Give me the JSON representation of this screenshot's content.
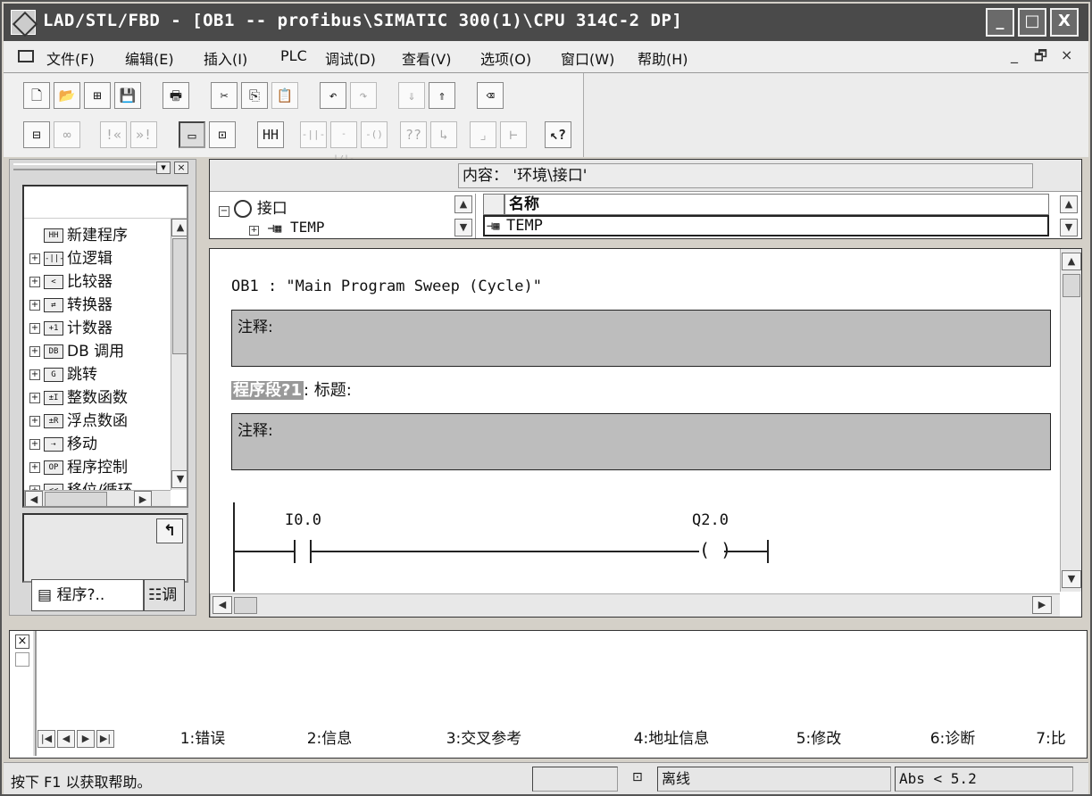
{
  "window": {
    "title": "LAD/STL/FBD  - [OB1 -- profibus\\SIMATIC 300(1)\\CPU 314C-2 DP]",
    "min_label": "_",
    "max_label": "□",
    "close_label": "X"
  },
  "menu": {
    "items": [
      "文件(F)",
      "编辑(E)",
      "插入(I)",
      "PLC",
      "调试(D)",
      "查看(V)",
      "选项(O)",
      "窗口(W)",
      "帮助(H)"
    ],
    "mdi_min": "_",
    "mdi_restore": "🗗",
    "mdi_close": "×"
  },
  "toolbar": {
    "row1": [
      {
        "icon": "new-icon",
        "glyph": "🗋"
      },
      {
        "icon": "open-icon",
        "glyph": "📂"
      },
      {
        "icon": "network-icon",
        "glyph": "⊞"
      },
      {
        "icon": "save-icon",
        "glyph": "💾"
      },
      {
        "icon": "print-icon",
        "glyph": "🖶"
      },
      {
        "icon": "cut-icon",
        "glyph": "✂"
      },
      {
        "icon": "copy-icon",
        "glyph": "⎘"
      },
      {
        "icon": "paste-icon",
        "glyph": "📋"
      },
      {
        "icon": "undo-icon",
        "glyph": "↶"
      },
      {
        "icon": "redo-icon",
        "glyph": "↷"
      },
      {
        "icon": "download-icon",
        "glyph": "⇓"
      },
      {
        "icon": "upload-icon",
        "glyph": "⇑"
      },
      {
        "icon": "overview-icon",
        "glyph": "⌫"
      }
    ],
    "row2": [
      {
        "icon": "online-icon",
        "glyph": "⊟"
      },
      {
        "icon": "monitor-icon",
        "glyph": "∞"
      },
      {
        "icon": "prev-network-icon",
        "glyph": "!«"
      },
      {
        "icon": "next-network-icon",
        "glyph": "»!"
      },
      {
        "icon": "view-icon",
        "glyph": "▭"
      },
      {
        "icon": "zoom-icon",
        "glyph": "⊡"
      },
      {
        "icon": "new-network-icon",
        "glyph": "HH"
      },
      {
        "icon": "no-contact-icon",
        "glyph": "-||-"
      },
      {
        "icon": "nc-contact-icon",
        "glyph": "-|/|-"
      },
      {
        "icon": "coil-icon",
        "glyph": "-()"
      },
      {
        "icon": "box-icon",
        "glyph": "??"
      },
      {
        "icon": "branch-open-icon",
        "glyph": "↳"
      },
      {
        "icon": "branch-close-icon",
        "glyph": "⌟"
      },
      {
        "icon": "connection-icon",
        "glyph": "⊢"
      },
      {
        "icon": "help-pointer-icon",
        "glyph": "↖?"
      }
    ]
  },
  "left_panel": {
    "tree": [
      {
        "label": "新建程序",
        "icon": "HH",
        "expand": ""
      },
      {
        "label": "位逻辑",
        "icon": "-||-",
        "expand": "+"
      },
      {
        "label": "比较器",
        "icon": "<",
        "expand": "+"
      },
      {
        "label": "转换器",
        "icon": "⇄",
        "expand": "+"
      },
      {
        "label": "计数器",
        "icon": "+1",
        "expand": "+"
      },
      {
        "label": "DB 调用",
        "icon": "DB",
        "expand": "+"
      },
      {
        "label": "跳转",
        "icon": "G",
        "expand": "+"
      },
      {
        "label": "整数函数",
        "icon": "±I",
        "expand": "+"
      },
      {
        "label": "浮点数函",
        "icon": "±R",
        "expand": "+"
      },
      {
        "label": "移动",
        "icon": "⇢",
        "expand": "+"
      },
      {
        "label": "程序控制",
        "icon": "OP",
        "expand": "+"
      },
      {
        "label": "移位/循环",
        "icon": "<<",
        "expand": "+"
      }
    ],
    "pin_glyph": "↰",
    "tab_program": "程序?..",
    "tab_call": "调"
  },
  "interface": {
    "content_label": "内容：  '环境\\接口'",
    "tree_root": "接口",
    "tree_child": "TEMP",
    "col_name": "名称",
    "row_temp": "TEMP"
  },
  "code": {
    "block_header": "OB1 :  \"Main Program Sweep (Cycle)\"",
    "comment_label": "注释:",
    "network_label": "程序段?1",
    "network_title": ": 标题:",
    "network_comment": "注释:",
    "contact_operand": "I0.0",
    "coil_operand": "Q2.0"
  },
  "messages": {
    "close_glyph": "×",
    "tabs": [
      "1:错误",
      "2:信息",
      "3:交叉参考",
      "4:地址信息",
      "5:修改",
      "6:诊断",
      "7:比"
    ],
    "active_tab": 1
  },
  "status": {
    "help_text": "按下 F1 以获取帮助。",
    "mode": "离线",
    "abs": "Abs < 5.2"
  }
}
